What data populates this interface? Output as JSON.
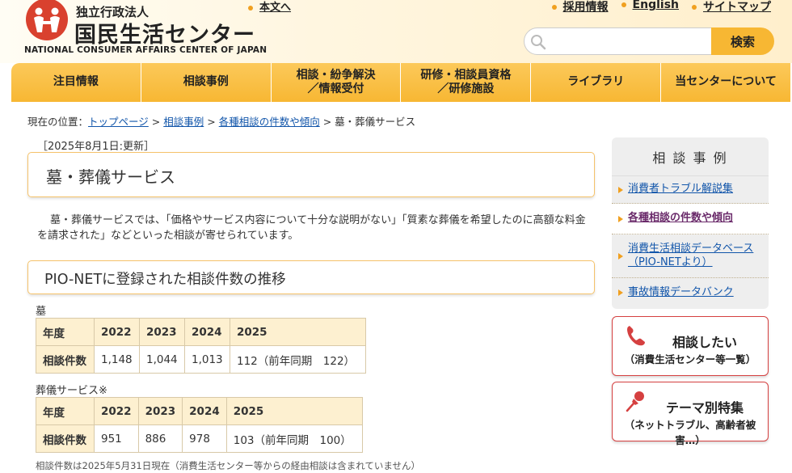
{
  "header": {
    "org_jp_small": "独立行政法人",
    "org_jp_large": "国民生活センター",
    "org_en": "NATIONAL CONSUMER AFFAIRS CENTER OF JAPAN",
    "skip_link": "本文へ",
    "top_links": [
      "採用情報",
      "English",
      "サイトマップ"
    ],
    "search": {
      "placeholder": "",
      "button": "検索"
    }
  },
  "nav": {
    "items": [
      "注目情報",
      "相談事例",
      "相談・紛争解決\n／情報受付",
      "研修・相談員資格\n／研修施設",
      "ライブラリ",
      "当センターについて"
    ]
  },
  "breadcrumb": {
    "prefix": "現在の位置：",
    "links": [
      "トップページ",
      "相談事例",
      "各種相談の件数や傾向"
    ],
    "sep": ">",
    "current": "墓・葬儀サービス"
  },
  "main": {
    "updated": "［2025年8月1日:更新］",
    "title": "墓・葬儀サービス",
    "intro": "墓・葬儀サービスでは、「価格やサービス内容について十分な説明がない」「質素な葬儀を希望したのに高額な料金を請求された」などといった相談が寄せられています。",
    "section_title": "PIO-NETに登録された相談件数の推移",
    "tables": [
      {
        "label": "墓",
        "header": [
          "年度",
          "2022",
          "2023",
          "2024",
          "2025"
        ],
        "row": [
          "相談件数",
          "1,148",
          "1,044",
          "1,013",
          "112（前年同期　122）"
        ]
      },
      {
        "label": "葬儀サービス※",
        "header": [
          "年度",
          "2022",
          "2023",
          "2024",
          "2025"
        ],
        "row": [
          "相談件数",
          "951",
          "886",
          "978",
          "103（前年同期　100）"
        ]
      }
    ],
    "note": "相談件数は2025年5月31日現在（消費生活センター等からの経由相談は含まれていません）"
  },
  "sidebar": {
    "title": "相 談 事 例",
    "items": [
      "消費者トラブル解説集",
      "各種相談の件数や傾向",
      "消費生活相談データベース\n（PIO-NETより）",
      "事故情報データバンク"
    ],
    "active_index": 1,
    "cta": [
      {
        "main": "相談したい",
        "sub": "（消費生活センター等一覧）",
        "icon": "phone-icon"
      },
      {
        "main": "テーマ別特集",
        "sub": "（ネットトラブル、高齢者被害…）",
        "icon": "pushpin-icon"
      }
    ]
  },
  "colors": {
    "accent": "#f7b733",
    "brand_red": "#d54040",
    "link": "#1155aa"
  }
}
